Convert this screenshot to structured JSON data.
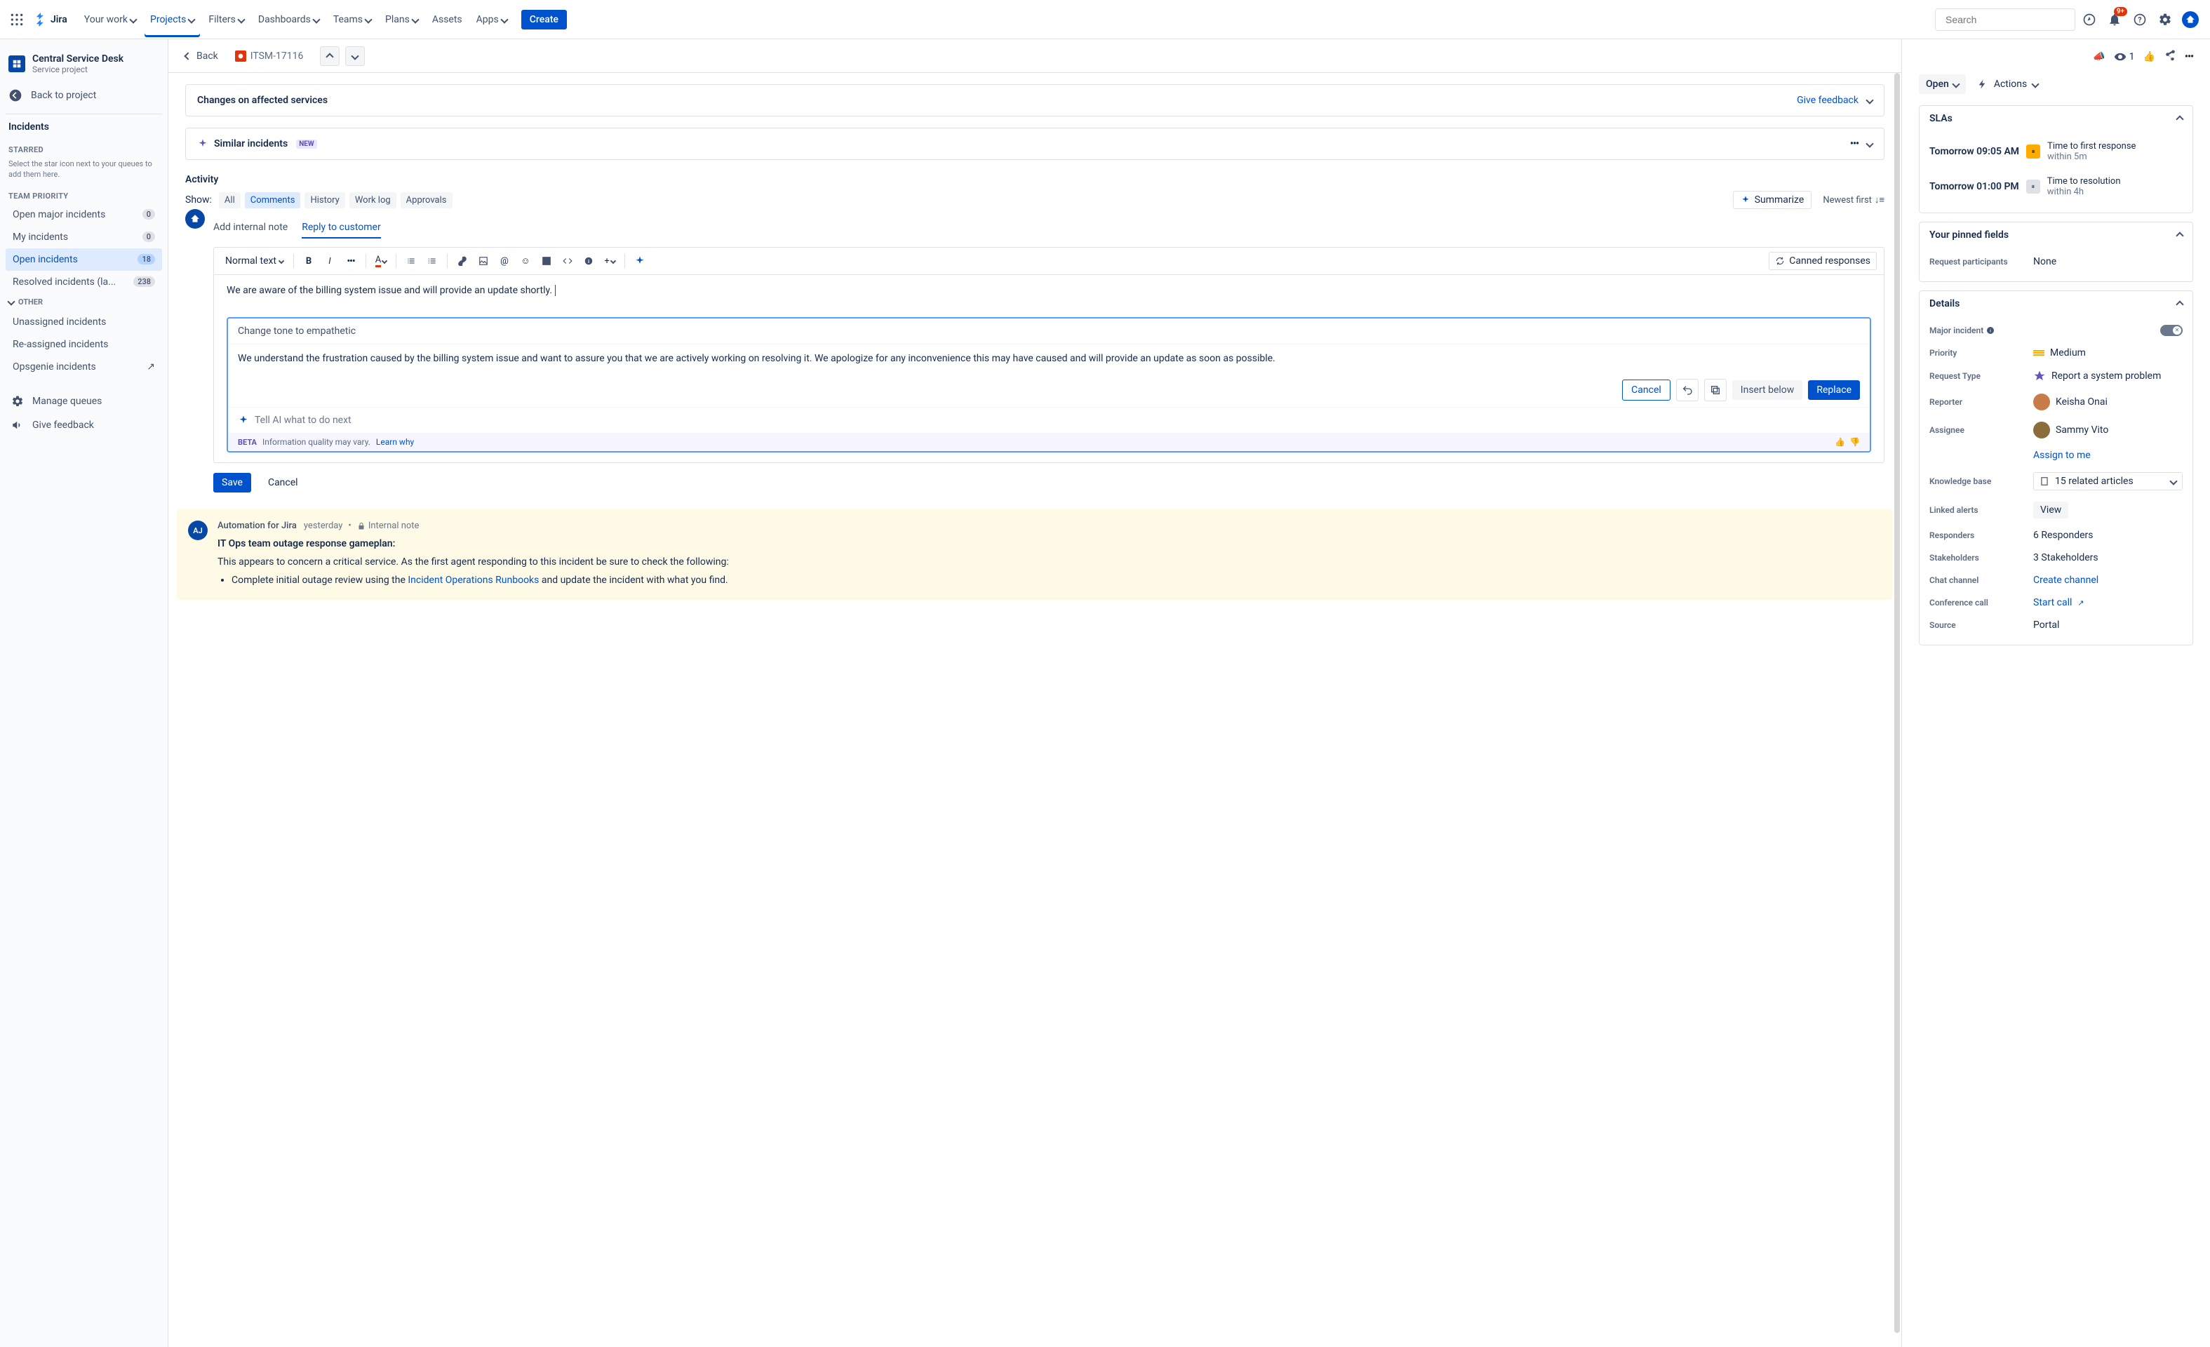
{
  "nav": {
    "logo": "Jira",
    "items": [
      "Your work",
      "Projects",
      "Filters",
      "Dashboards",
      "Teams",
      "Plans",
      "Assets",
      "Apps"
    ],
    "active": "Projects",
    "create": "Create",
    "search_placeholder": "Search",
    "notification_badge": "9+"
  },
  "sidebar": {
    "project_name": "Central Service Desk",
    "project_type": "Service project",
    "back_to_project": "Back to project",
    "incidents_title": "Incidents",
    "starred_label": "STARRED",
    "starred_help": "Select the star icon next to your queues to add them here.",
    "priority_label": "TEAM PRIORITY",
    "queues": [
      {
        "label": "Open major incidents",
        "count": "0"
      },
      {
        "label": "My incidents",
        "count": "0"
      },
      {
        "label": "Open incidents",
        "count": "18",
        "selected": true
      },
      {
        "label": "Resolved incidents (la...",
        "count": "238"
      }
    ],
    "other_label": "OTHER",
    "other_queues": [
      {
        "label": "Unassigned incidents"
      },
      {
        "label": "Re-assigned incidents"
      },
      {
        "label": "Opsgenie incidents",
        "external": true
      }
    ],
    "manage_queues": "Manage queues",
    "give_feedback": "Give feedback"
  },
  "issue": {
    "back": "Back",
    "key": "ITSM-17116",
    "affected_title": "Changes on affected services",
    "give_feedback": "Give feedback",
    "similar_title": "Similar incidents",
    "new_badge": "NEW"
  },
  "activity": {
    "heading": "Activity",
    "show_label": "Show:",
    "tabs": [
      "All",
      "Comments",
      "History",
      "Work log",
      "Approvals"
    ],
    "active_tab": "Comments",
    "summarize": "Summarize",
    "sort": "Newest first",
    "comment_tabs": {
      "internal": "Add internal note",
      "reply": "Reply to customer"
    },
    "toolbar": {
      "style": "Normal text",
      "canned": "Canned responses"
    },
    "draft": "We are aware of the billing system issue and will provide an update shortly.",
    "ai": {
      "prompt_used": "Change tone to empathetic",
      "suggestion": "We understand the frustration caused by the billing system issue and want to assure you that we are actively working on resolving it. We apologize for any inconvenience this may have caused and will provide an update as soon as possible.",
      "cancel": "Cancel",
      "insert_below": "Insert below",
      "replace": "Replace",
      "next_prompt": "Tell AI what to do next",
      "beta": "BETA",
      "disclaimer": "Information quality may vary.",
      "learn": "Learn why"
    },
    "save": "Save",
    "cancel_outer": "Cancel"
  },
  "automation": {
    "avatar": "AJ",
    "author": "Automation for Jira",
    "when": "yesterday",
    "note_label": "Internal note",
    "title": "IT Ops team outage response gameplan:",
    "body": "This appears to concern a critical service. As the first agent responding to this incident be sure to check the following:",
    "bullet_pre": "Complete initial outage review using the ",
    "bullet_link": "Incident Operations Runbooks",
    "bullet_post": " and update the incident with what you find."
  },
  "right": {
    "status": "Open",
    "actions": "Actions",
    "watchers": "1",
    "slas_title": "SLAs",
    "slas": [
      {
        "time": "Tomorrow 09:05 AM",
        "label": "Time to first response",
        "sub": "within 5m",
        "warn": true
      },
      {
        "time": "Tomorrow 01:00 PM",
        "label": "Time to resolution",
        "sub": "within 4h",
        "warn": false
      }
    ],
    "pinned_title": "Your pinned fields",
    "pinned": {
      "label": "Request participants",
      "value": "None"
    },
    "details_title": "Details",
    "fields": {
      "major_incident_label": "Major incident",
      "priority_label": "Priority",
      "priority_value": "Medium",
      "request_type_label": "Request Type",
      "request_type_value": "Report a system problem",
      "reporter_label": "Reporter",
      "reporter_value": "Keisha Onai",
      "assignee_label": "Assignee",
      "assignee_value": "Sammy Vito",
      "assign_to_me": "Assign to me",
      "kb_label": "Knowledge base",
      "kb_value": "15 related articles",
      "linked_alerts_label": "Linked alerts",
      "linked_alerts_value": "View",
      "responders_label": "Responders",
      "responders_value": "6 Responders",
      "stakeholders_label": "Stakeholders",
      "stakeholders_value": "3 Stakeholders",
      "chat_label": "Chat channel",
      "chat_value": "Create channel",
      "conf_label": "Conference call",
      "conf_value": "Start call",
      "source_label": "Source",
      "source_value": "Portal"
    }
  }
}
